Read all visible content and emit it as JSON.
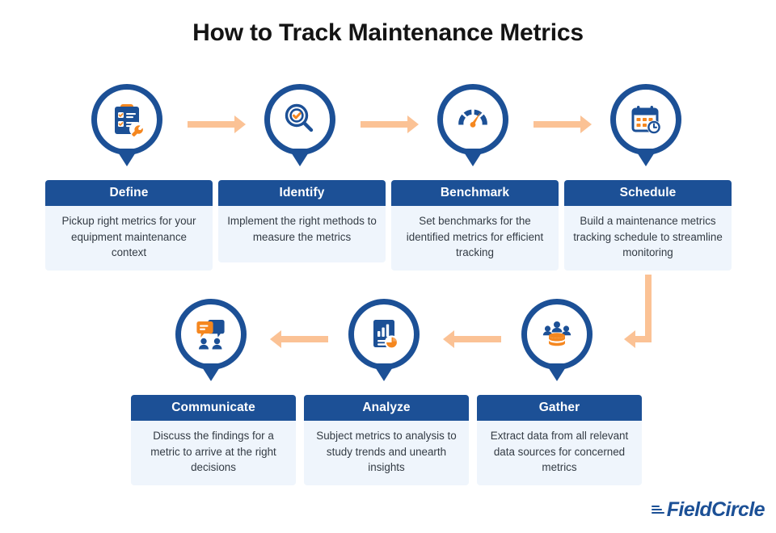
{
  "title": "How to Track Maintenance Metrics",
  "colors": {
    "header_blue": "#1c5096",
    "body_light": "#eff5fc",
    "arrow_peach": "#fbc295",
    "icon_orange": "#f5871f",
    "title_black": "#141414",
    "background": "#ffffff"
  },
  "steps": [
    {
      "title": "Define",
      "description": "Pickup right metrics for your equipment maintenance context",
      "icon": "clipboard-wrench-icon"
    },
    {
      "title": "Identify",
      "description": "Implement the right methods to measure the metrics",
      "icon": "magnifier-check-icon"
    },
    {
      "title": "Benchmark",
      "description": "Set benchmarks for the identified metrics for efficient tracking",
      "icon": "speedometer-icon"
    },
    {
      "title": "Schedule",
      "description": "Build a maintenance metrics tracking schedule to streamline monitoring",
      "icon": "calendar-clock-icon"
    },
    {
      "title": "Gather",
      "description": "Extract data from all relevant data sources for concerned metrics",
      "icon": "database-people-icon"
    },
    {
      "title": "Analyze",
      "description": "Subject metrics to analysis to study trends and unearth insights",
      "icon": "report-chart-icon"
    },
    {
      "title": "Communicate",
      "description": "Discuss the findings for a metric to arrive at the right decisions",
      "icon": "chat-people-icon"
    }
  ],
  "connectors": [
    {
      "name": "arrow-define-to-identify",
      "direction": "right"
    },
    {
      "name": "arrow-identify-to-benchmark",
      "direction": "right"
    },
    {
      "name": "arrow-benchmark-to-schedule",
      "direction": "right"
    },
    {
      "name": "elbow-schedule-to-gather",
      "direction": "down-left"
    },
    {
      "name": "arrow-gather-to-analyze",
      "direction": "left"
    },
    {
      "name": "arrow-analyze-to-communicate",
      "direction": "left"
    }
  ],
  "logo": {
    "text": "FieldCircle"
  }
}
